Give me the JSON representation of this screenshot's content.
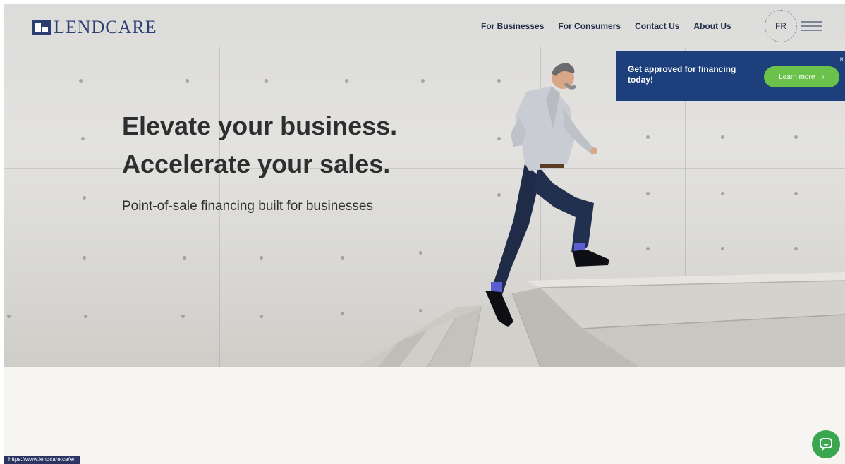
{
  "brand": {
    "name": "LENDCARE"
  },
  "nav": {
    "items": [
      "For Businesses",
      "For Consumers",
      "Contact Us",
      "About Us"
    ]
  },
  "lang_toggle": {
    "label": "FR"
  },
  "promo": {
    "text": "Get approved for financing today!",
    "button_label": "Learn more",
    "close": "×"
  },
  "hero": {
    "headline_1": "Elevate your business.",
    "headline_2": "Accelerate your sales.",
    "subheadline": "Point-of-sale financing built for businesses"
  },
  "status_bar": {
    "url": "https://www.lendcare.ca/en"
  },
  "colors": {
    "brand_navy": "#1d3f7c",
    "cta_green": "#6bc24a",
    "chat_green": "#3aa64f",
    "text_dark": "#2e2e30"
  },
  "icons": {
    "menu": "hamburger-icon",
    "chat": "chat-bubble-icon",
    "chevron": "chevron-right-icon"
  }
}
